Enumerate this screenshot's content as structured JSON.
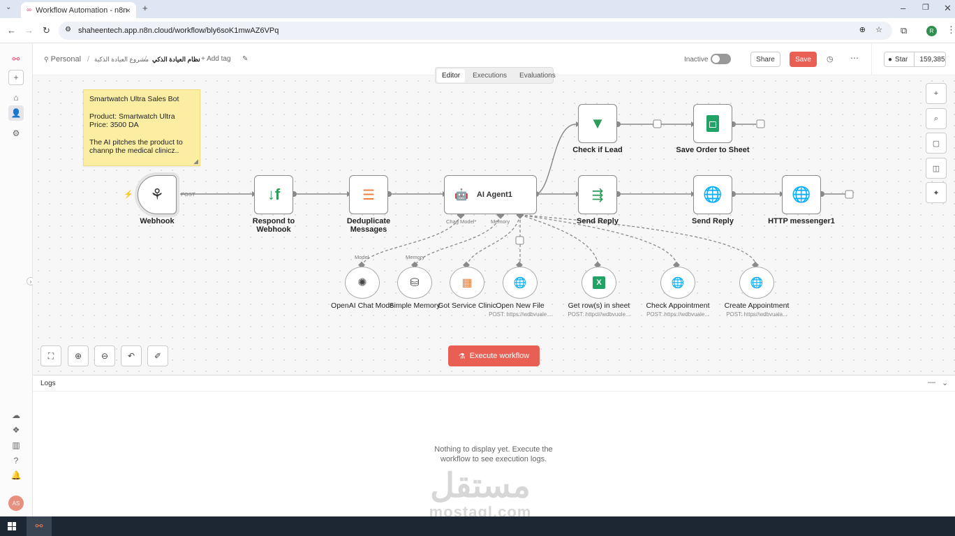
{
  "browser": {
    "tab_title": "Workflow Automation - n8n",
    "url": "shaheentech.app.n8n.cloud/workflow/bly6soK1mwAZ6VPq",
    "profile_initial": "R"
  },
  "header": {
    "crumb_personal": "Personal",
    "crumb_project": "مشروع العيادة الذكية",
    "crumb_workflow": "نظام العيادة الذكي",
    "add_tag": "+ Add tag",
    "status": "Inactive",
    "share_label": "Share",
    "save_label": "Save",
    "star_label": "Star",
    "star_count": "159,385"
  },
  "canvas_tabs": [
    "Editor",
    "Executions",
    "Evaluations"
  ],
  "sticky_note": {
    "title": "Smartwatch Ultra Sales Bot",
    "body": "Product: Smartwatch Ultra\nPrice: 3500 DA",
    "footer": "The AI pitches the product to\nchannp the medical clinicz.."
  },
  "nodes": {
    "webhook": "Webhook",
    "webhook_port": "POST",
    "respond": "Respond to Webhook",
    "dedupe": "Deduplicate Messages",
    "agent": "AI Agent1",
    "agent_port_model": "Chag Model*",
    "agent_port_memory": "Memory",
    "check_lead": "Check if Lead",
    "save_order": "Save Order to Sheet",
    "send_reply_1": "Send Reply",
    "send_reply_2": "Send Reply",
    "http_messenger": "HTTP messenger1"
  },
  "sub_nodes": {
    "model_port": "Model",
    "memory_port": "Memory",
    "openai": "OpenAI Chat Mode",
    "memory": "Simple Memory",
    "got_service": "Got Service Clinic",
    "open_file": "Open New File",
    "open_file_note": "POST: https://wdbvuale...",
    "get_rows": "Get row(s) in sheet",
    "get_rows_note": "POST: httpcl//wdbvuole...",
    "check_appt": "Check Appointment",
    "check_appt_note": "POST: https://wdbvuale...",
    "create_appt": "Create Appointment",
    "create_appt_note": "POST: https//wdbvuala..."
  },
  "execute_label": "Execute workflow",
  "logs": {
    "title": "Logs",
    "empty": "Nothing to display yet. Execute the workflow to see execution logs."
  },
  "watermark": {
    "arabic": "مستقل",
    "latin": "mostaql.com"
  },
  "user_initials": "AS",
  "colors": {
    "accent": "#ea5f53",
    "sticky": "#fbeea3",
    "sheets_green": "#21a366",
    "filter_green": "#2e9c58"
  }
}
